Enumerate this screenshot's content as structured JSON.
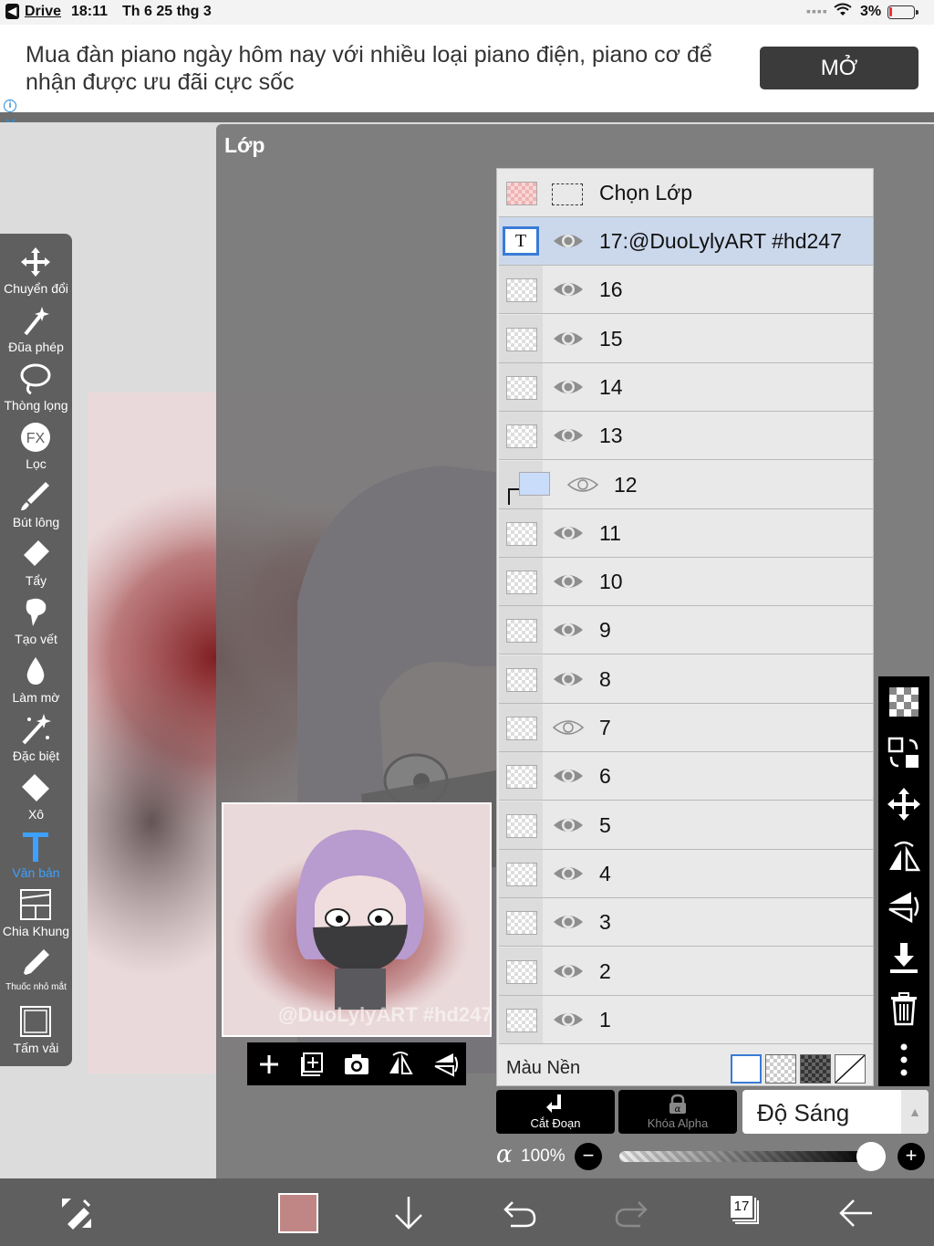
{
  "status_bar": {
    "back_app": "Drive",
    "time": "18:11",
    "date": "Th 6 25 thg 3",
    "battery": "3%"
  },
  "ad": {
    "text": "Mua đàn piano ngày hôm nay với nhiều loại piano điện, piano cơ để nhận được ưu đãi cực sốc",
    "button": "MỞ"
  },
  "dialog": {
    "title": "Lớp"
  },
  "tools": [
    {
      "label": "Chuyển đổi",
      "icon": "move-icon"
    },
    {
      "label": "Đũa phép",
      "icon": "magic-wand-icon"
    },
    {
      "label": "Thòng lọng",
      "icon": "lasso-icon"
    },
    {
      "label": "Lọc",
      "icon": "fx-icon"
    },
    {
      "label": "Bút lông",
      "icon": "brush-icon"
    },
    {
      "label": "Tẩy",
      "icon": "eraser-icon"
    },
    {
      "label": "Tạo vết",
      "icon": "smudge-icon"
    },
    {
      "label": "Làm mờ",
      "icon": "blur-icon"
    },
    {
      "label": "Đặc biệt",
      "icon": "special-icon"
    },
    {
      "label": "Xô",
      "icon": "bucket-icon"
    },
    {
      "label": "Văn bản",
      "icon": "text-icon",
      "active": true
    },
    {
      "label": "Chia Khung",
      "icon": "frame-divider-icon"
    },
    {
      "label": "Thuốc nhỏ mắt",
      "icon": "eyedropper-icon"
    },
    {
      "label": "Tấm vải",
      "icon": "canvas-icon"
    }
  ],
  "preview": {
    "watermark": "@DuoLylyART #hd247"
  },
  "layers": {
    "select_label": "Chọn Lớp",
    "items": [
      {
        "name": "17:@DuoLylyART #hd247",
        "type": "text",
        "visible": true,
        "selected": true
      },
      {
        "name": "16",
        "visible": true
      },
      {
        "name": "15",
        "visible": true
      },
      {
        "name": "14",
        "visible": true
      },
      {
        "name": "13",
        "visible": true
      },
      {
        "name": "12",
        "visible": true,
        "clipped": true
      },
      {
        "name": "11",
        "visible": true
      },
      {
        "name": "10",
        "visible": true
      },
      {
        "name": "9",
        "visible": true
      },
      {
        "name": "8",
        "visible": true
      },
      {
        "name": "7",
        "visible": false
      },
      {
        "name": "6",
        "visible": true
      },
      {
        "name": "5",
        "visible": true
      },
      {
        "name": "4",
        "visible": true
      },
      {
        "name": "3",
        "visible": true
      },
      {
        "name": "2",
        "visible": true
      },
      {
        "name": "1",
        "visible": true
      }
    ],
    "background_label": "Màu Nền"
  },
  "controls": {
    "clip_label": "Cắt Đoạn",
    "alpha_lock_label": "Khóa Alpha",
    "blend_mode": "Độ Sáng",
    "opacity_symbol": "α",
    "opacity": "100%"
  },
  "bottom": {
    "color": "#c08686",
    "layer_count": "17"
  }
}
